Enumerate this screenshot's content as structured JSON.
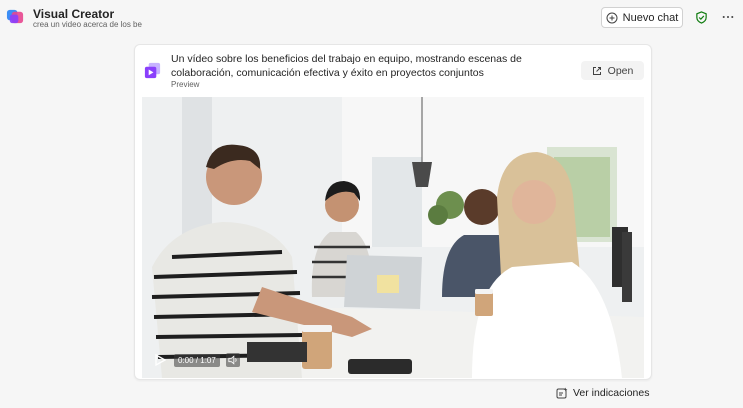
{
  "header": {
    "title": "Visual Creator",
    "subtitle": "crea un video acerca de los be",
    "new_chat_label": "Nuevo chat"
  },
  "card": {
    "title": "Un vídeo sobre los beneficios del trabajo en equipo, mostrando escenas de colaboración, comunicación efectiva y éxito en proyectos conjuntos",
    "preview_label": "Preview",
    "open_label": "Open"
  },
  "video": {
    "time": "0:00 / 1:07"
  },
  "footer": {
    "ver_indicaciones_label": "Ver indicaciones"
  },
  "colors": {
    "shield": "#107c10",
    "logo_primary": "#8a3ffc",
    "logo_secondary": "#e8468f"
  }
}
